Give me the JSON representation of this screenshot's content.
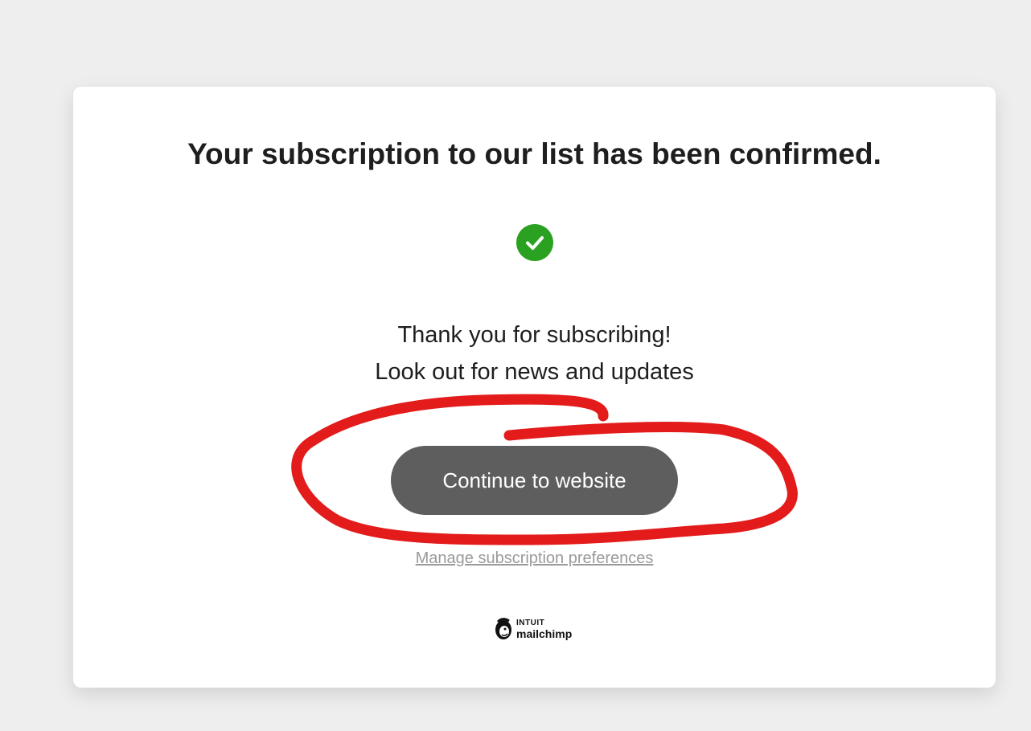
{
  "confirmation": {
    "title": "Your subscription to our list has been confirmed.",
    "message_line1": "Thank you for subscribing!",
    "message_line2": "Look out for news and updates",
    "continue_label": "Continue to website",
    "manage_label": "Manage subscription preferences"
  },
  "footer": {
    "logo_top": "INTUIT",
    "logo_bottom": "mailchimp"
  },
  "icons": {
    "success": "checkmark-circle-icon",
    "brand": "mailchimp-logo-icon"
  },
  "colors": {
    "success_green": "#2aa121",
    "button_bg": "#5e5e5e",
    "link_gray": "#9a9a9a",
    "annotation_red": "#e31b1b"
  }
}
